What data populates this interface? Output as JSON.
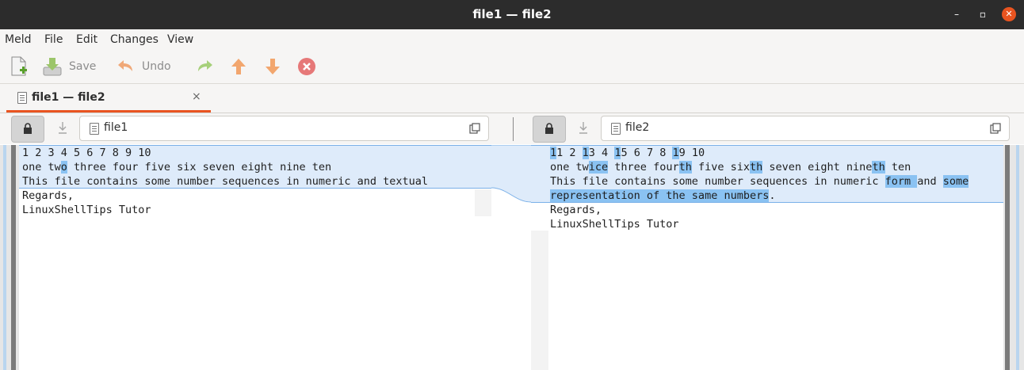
{
  "window": {
    "title": "file1 — file2",
    "min_glyph": "–",
    "max_glyph": "▫",
    "close_glyph": "✕"
  },
  "menu": [
    "Meld",
    "File",
    "Edit",
    "Changes",
    "View"
  ],
  "toolbar": {
    "save_label": "Save",
    "undo_label": "Undo"
  },
  "tab": {
    "label": "file1 — file2",
    "close_glyph": "×"
  },
  "left": {
    "filename": "file1"
  },
  "right": {
    "filename": "file2"
  },
  "colors": {
    "accent": "#e95420",
    "change_bg": "#deebfa",
    "change_highlight": "#8ac2f2",
    "titlebar": "#2c2c2c"
  }
}
